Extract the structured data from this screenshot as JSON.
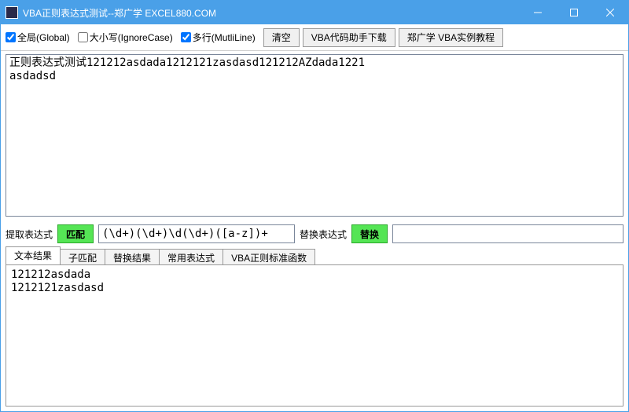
{
  "titlebar": {
    "title": "VBA正则表达式测试--郑广学  EXCEL880.COM"
  },
  "toolbar": {
    "global_label": "全局(Global)",
    "global_checked": true,
    "ignorecase_label": "大小写(IgnoreCase)",
    "ignorecase_checked": false,
    "multiline_label": "多行(MutliLine)",
    "multiline_checked": true,
    "clear": "清空",
    "download": "VBA代码助手下载",
    "tutorial": "郑广学 VBA实例教程"
  },
  "source_text": "正则表达式测试121212asdada1212121zasdasd121212AZdada1221\nasdadsd",
  "expr": {
    "extract_label": "提取表达式",
    "match_btn": "匹配",
    "pattern": "(\\d+)(\\d+)\\d(\\d+)([a-z])+",
    "replace_label": "替换表达式",
    "replace_btn": "替换",
    "replace_value": ""
  },
  "tabs": [
    {
      "label": "文本结果",
      "active": true
    },
    {
      "label": "子匹配",
      "active": false
    },
    {
      "label": "替换结果",
      "active": false
    },
    {
      "label": "常用表达式",
      "active": false
    },
    {
      "label": "VBA正则标准函数",
      "active": false
    }
  ],
  "result_text": "121212asdada\n1212121zasdasd"
}
